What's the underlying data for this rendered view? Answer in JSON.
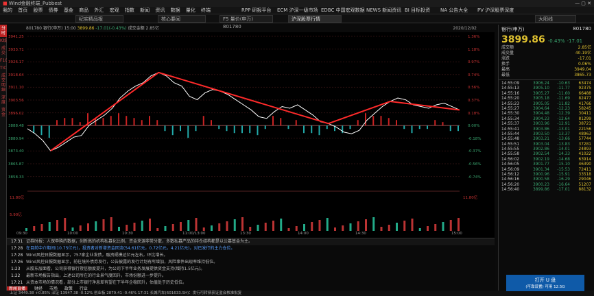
{
  "window": {
    "title": "Wind金融终端_Pubbest"
  },
  "menu": [
    "我的",
    "首页",
    "股票",
    "债券",
    "基金",
    "商品",
    "外汇",
    "宏观",
    "指数",
    "新闻",
    "资讯",
    "数据",
    "量化",
    "终端"
  ],
  "top_tabs": [
    "RPP 研报平台",
    "ECM 沪深一级市场",
    "EDBC 中国宏观数据",
    "NEWS 新闻资讯",
    "BI 目标投资",
    "NA 公告大全",
    "PV 沪深股票深度"
  ],
  "chart_tabs": [
    "纪实精品报",
    "核心要闻",
    "F5 量价(申万) 801780",
    "沪深股票行情",
    "大阳线"
  ],
  "left_vtabs": [
    "分时",
    "K线",
    "成交",
    "F10",
    "TICK",
    "成交明细",
    "深度",
    "资金"
  ],
  "chart_header": {
    "code": "801780",
    "name": "银行(申万)",
    "time": "15:00",
    "price": "3899.86",
    "change": "-17.01(-0.43%)",
    "amount_label": "成交金额",
    "amount": "2.85亿",
    "date": "2020/12/02"
  },
  "y_left": [
    "3941.25",
    "3933.71",
    "3926.17",
    "3918.64",
    "3911.10",
    "3903.56",
    "3896.02",
    "3888.48",
    "3880.94",
    "3873.40",
    "3865.87",
    "3858.33"
  ],
  "y_right": [
    "1.36%",
    "1.18%",
    "0.97%",
    "0.74%",
    "0.56%",
    "0.37%",
    "0.18%",
    "0.00%",
    "-0.18%",
    "-0.37%",
    "-0.56%",
    "-0.74%"
  ],
  "vol_labels": [
    "11.80亿",
    "5.90亿"
  ],
  "x_labels": [
    "09:30",
    "10:00",
    "10:30",
    "11:00/13:00",
    "13:30",
    "14:00",
    "14:30",
    "15:00"
  ],
  "chart_data": {
    "type": "line",
    "series": [
      {
        "values": [
          3887,
          3884,
          3880,
          3874,
          3876,
          3879,
          3882,
          3883,
          3889,
          3892,
          3895,
          3899,
          3905,
          3909,
          3912,
          3914,
          3918,
          3920,
          3918,
          3914,
          3912,
          3906,
          3904,
          3908,
          3910,
          3909,
          3907,
          3904,
          3901,
          3898,
          3894,
          3893,
          3897,
          3900,
          3899,
          3901,
          3898,
          3895,
          3891,
          3890,
          3888,
          3885,
          3884,
          3886,
          3892,
          3896,
          3900,
          3903,
          3905,
          3904,
          3901,
          3900,
          3899,
          3901,
          3902,
          3900,
          3898
        ]
      }
    ]
  },
  "right_panel": {
    "name": "银行(申万)",
    "code": "801780",
    "price": "3899.86",
    "change": "-0.43%",
    "change_abs": "-17.01",
    "stats": [
      {
        "k": "成交额",
        "v": "2.85亿"
      },
      {
        "k": "成交量",
        "v": "40.19亿"
      },
      {
        "k": "涨跌",
        "v": "-17.01"
      },
      {
        "k": "换手",
        "v": "0.06%"
      },
      {
        "k": "最高",
        "v": "3949.04"
      },
      {
        "k": "最低",
        "v": "3865.73"
      }
    ],
    "ticks": [
      {
        "t": "14:55:09",
        "p": "3906.24",
        "d": "-10.63",
        "v": "63474"
      },
      {
        "t": "14:55:13",
        "p": "3905.10",
        "d": "-11.77",
        "v": "92375"
      },
      {
        "t": "14:55:16",
        "p": "3905.27",
        "d": "-11.60",
        "v": "66488"
      },
      {
        "t": "14:55:20",
        "p": "3905.18",
        "d": "-11.69",
        "v": "82477"
      },
      {
        "t": "14:55:23",
        "p": "3905.05",
        "d": "-11.82",
        "v": "41766"
      },
      {
        "t": "14:55:27",
        "p": "3904.64",
        "d": "-12.23",
        "v": "58245"
      },
      {
        "t": "14:55:30",
        "p": "3904.48",
        "d": "-12.39",
        "v": "30411"
      },
      {
        "t": "14:55:34",
        "p": "3904.23",
        "d": "-12.64",
        "v": "81299"
      },
      {
        "t": "14:55:37",
        "p": "3903.96",
        "d": "-12.91",
        "v": "38721"
      },
      {
        "t": "14:55:41",
        "p": "3903.86",
        "d": "-13.01",
        "v": "22156"
      },
      {
        "t": "14:55:44",
        "p": "3903.50",
        "d": "-13.37",
        "v": "48963"
      },
      {
        "t": "14:55:48",
        "p": "3903.21",
        "d": "-13.66",
        "v": "57744"
      },
      {
        "t": "14:55:51",
        "p": "3903.04",
        "d": "-13.83",
        "v": "37281"
      },
      {
        "t": "14:55:55",
        "p": "3902.86",
        "d": "-14.01",
        "v": "24893"
      },
      {
        "t": "14:55:58",
        "p": "3902.54",
        "d": "-14.33",
        "v": "41022"
      },
      {
        "t": "14:56:02",
        "p": "3902.19",
        "d": "-14.68",
        "v": "63914"
      },
      {
        "t": "14:56:05",
        "p": "3901.77",
        "d": "-15.10",
        "v": "46390"
      },
      {
        "t": "14:56:09",
        "p": "3901.34",
        "d": "-15.53",
        "v": "72411"
      },
      {
        "t": "14:56:12",
        "p": "3900.96",
        "d": "-15.91",
        "v": "33518"
      },
      {
        "t": "14:56:16",
        "p": "3900.58",
        "d": "-16.29",
        "v": "29046"
      },
      {
        "t": "14:56:20",
        "p": "3900.23",
        "d": "-16.64",
        "v": "51207"
      },
      {
        "t": "14:56:40",
        "p": "3899.86",
        "d": "-17.01",
        "v": "88132"
      }
    ],
    "ad": {
      "title": "打开 U 盘",
      "sub": "(可靠设置) 可用 12.5G"
    }
  },
  "news": [
    {
      "time": "17:31",
      "text": "证券时报：人保申购的数据，创新高的机构私募化比例，资金来源非常分散，多数私募产品的持仓结构都是以公募基金为主。",
      "cls": "hl"
    },
    {
      "time": "17:28",
      "text": "在目前中介期间(10.75亿元)，投资者对新增资金回流(54.61亿元，0.72亿元，4.21亿元)，对已发行的主力仓位。",
      "cls": "blue"
    },
    {
      "time": "17:28",
      "text": "Wind风控日报数据显示，757家企业发债，融资规模达亿元左右，环比增长。",
      "cls": ""
    },
    {
      "time": "17:26",
      "text": "Wind风控日报数据显示，前往境外债券发行，公告披露的发行计划有所增加，风险事件出现率维持低位。",
      "cls": ""
    },
    {
      "time": "1:23",
      "text": "从股东层面看，公司获得银行授信额度提升，为公司下半年业务发展提供资金支持(增持1.5亿元)。",
      "cls": ""
    },
    {
      "time": "1:22",
      "text": "最新市场报告指出，上述公司所在的行业景气度回升，市场份额进一步提升。",
      "cls": ""
    },
    {
      "time": "17:21",
      "text": "从资本市场的情况看，部分上市银行净息差有望在下半年企稳回升，估值处于历史低位。",
      "cls": ""
    }
  ],
  "news_tabs": [
    "新闻直播",
    "财经",
    "市场",
    "政策",
    "行业"
  ],
  "bottom_bar": "上证 3449.38 +0.85%  深证 13947.38 -0.12%  创业板 2879.41 -0.46%  17:31 长城汽车(601633.SH)：发行可转债获证监会核准批复"
}
